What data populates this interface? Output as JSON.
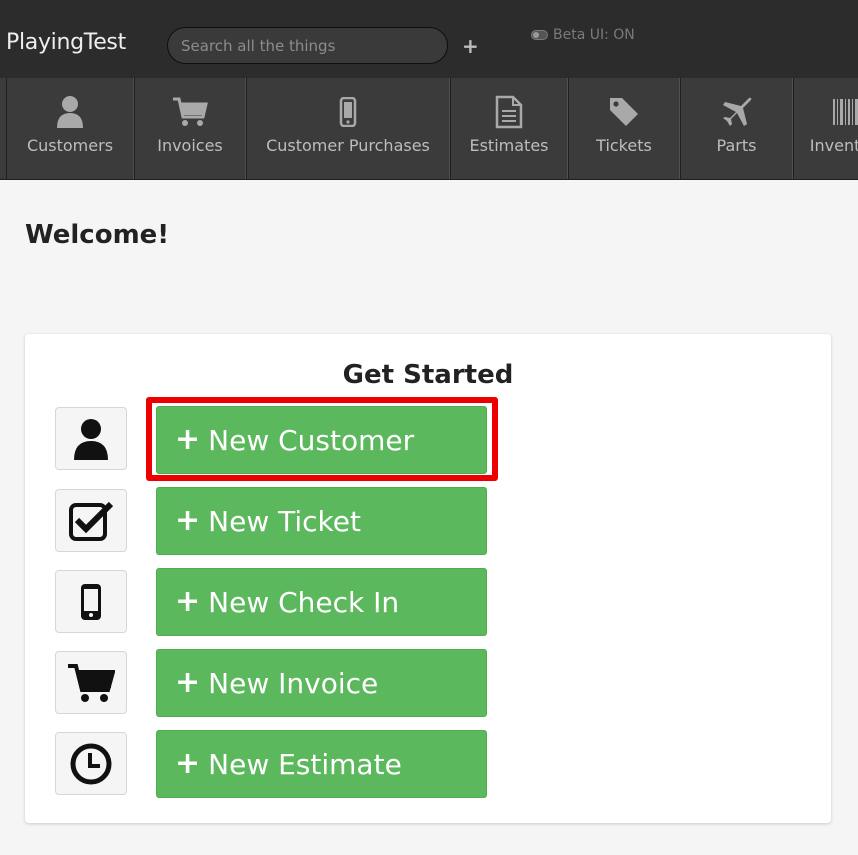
{
  "header": {
    "app_title": "PlayingTest",
    "search_placeholder": "Search all the things",
    "add_label": "+",
    "beta_label": "Beta UI: ON"
  },
  "nav": {
    "items": [
      {
        "label": "Customers",
        "icon": "user-icon"
      },
      {
        "label": "Invoices",
        "icon": "cart-icon"
      },
      {
        "label": "Customer Purchases",
        "icon": "phone-icon"
      },
      {
        "label": "Estimates",
        "icon": "document-icon"
      },
      {
        "label": "Tickets",
        "icon": "tag-icon"
      },
      {
        "label": "Parts",
        "icon": "plane-icon"
      },
      {
        "label": "Inventory",
        "icon": "barcode-icon"
      }
    ]
  },
  "main": {
    "welcome": "Welcome!",
    "get_started": {
      "title": "Get Started",
      "actions": [
        {
          "label": "New Customer",
          "icon": "user-icon",
          "highlighted": true
        },
        {
          "label": "New Ticket",
          "icon": "checkbox-icon"
        },
        {
          "label": "New Check In",
          "icon": "phone-icon"
        },
        {
          "label": "New Invoice",
          "icon": "cart-icon"
        },
        {
          "label": "New Estimate",
          "icon": "clock-icon"
        }
      ]
    }
  },
  "colors": {
    "header_bg": "#2c2c2c",
    "nav_bg": "#3b3b3b",
    "button_green": "#5cb85c",
    "highlight_red": "#ee0000"
  }
}
